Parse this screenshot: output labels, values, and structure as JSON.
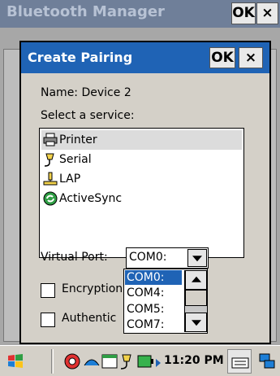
{
  "window": {
    "title": "Bluetooth Manager",
    "ok_label": "OK",
    "close_label": "×"
  },
  "dialog": {
    "title": "Create Pairing",
    "ok_label": "OK",
    "close_label": "×",
    "name_label": "Name:",
    "name_value": "Device 2",
    "select_service_label": "Select a service:",
    "services": [
      "Printer",
      "Serial",
      "LAP",
      "ActiveSync"
    ],
    "virtual_port_label": "Virtual Port:",
    "virtual_port_value": "COM0:",
    "port_options": [
      "COM0:",
      "COM4:",
      "COM5:",
      "COM7:"
    ],
    "encryption_label": "Encryption",
    "authentication_label": "Authentic"
  },
  "taskbar": {
    "time": "11:20 PM"
  },
  "colors": {
    "titlebar": "#1f63b5",
    "selection": "#1f63b5",
    "window_titlebar": "#6f7f99"
  }
}
